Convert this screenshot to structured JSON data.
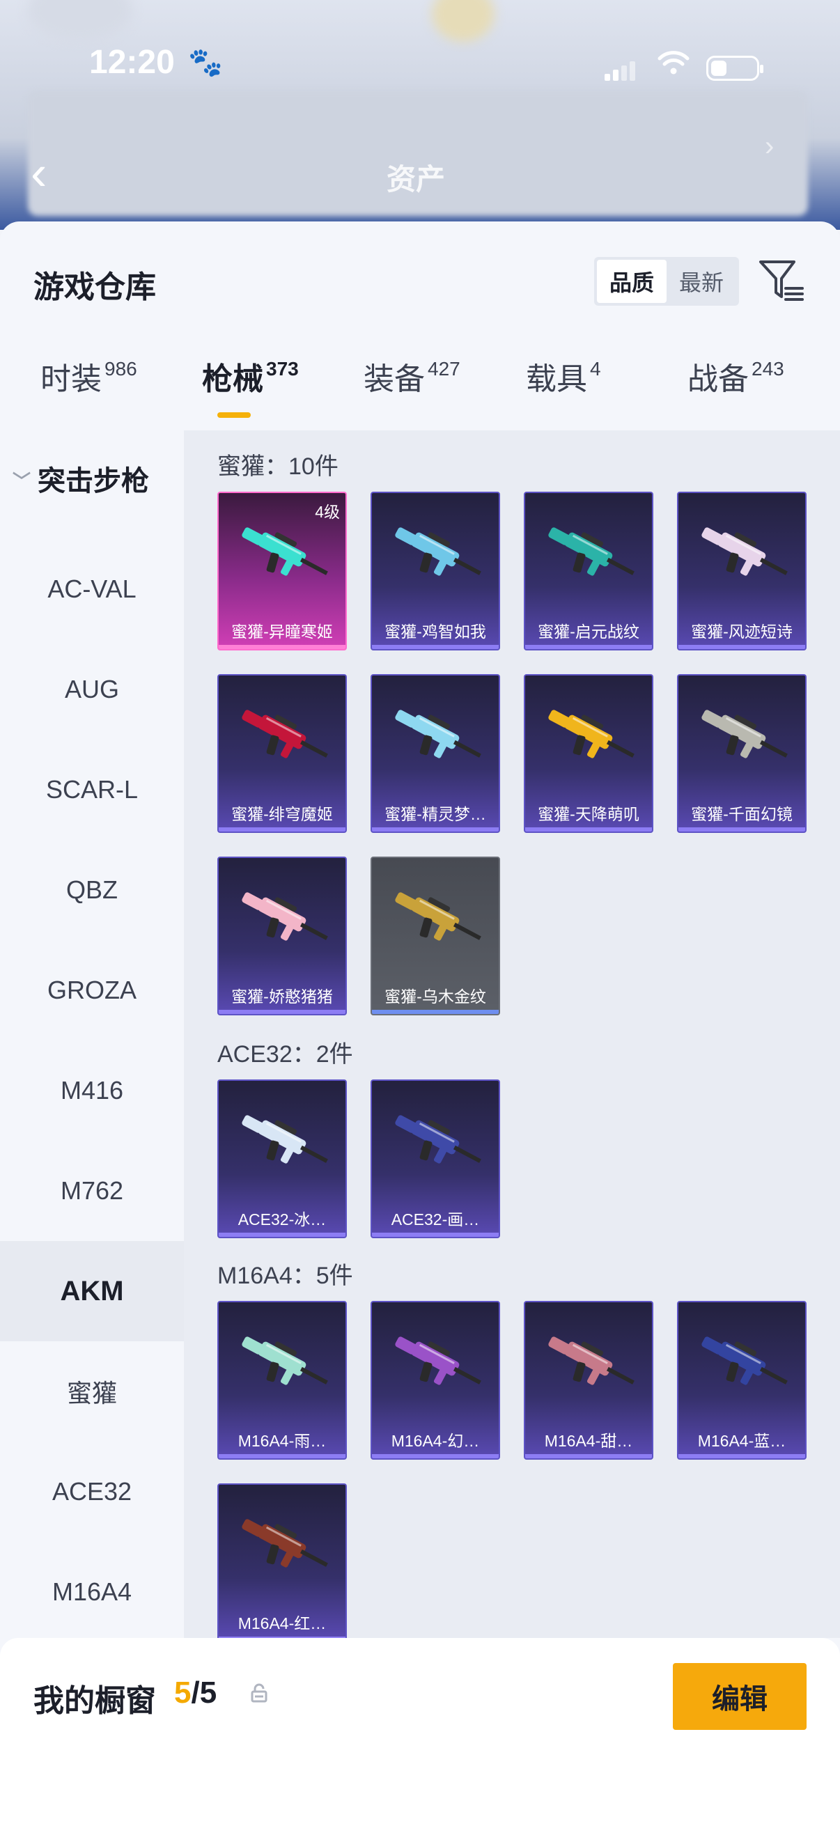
{
  "status_bar": {
    "time": "12:20",
    "paw_glyph": "🐾"
  },
  "header": {
    "title": "资产",
    "back_glyph": "‹",
    "next_glyph": "›"
  },
  "warehouse": {
    "title": "游戏仓库",
    "sort_options": [
      {
        "label": "品质",
        "active": true
      },
      {
        "label": "最新",
        "active": false
      }
    ]
  },
  "tabs": [
    {
      "label": "时装",
      "count": "986",
      "active": false
    },
    {
      "label": "枪械",
      "count": "373",
      "active": true
    },
    {
      "label": "装备",
      "count": "427",
      "active": false
    },
    {
      "label": "载具",
      "count": "4",
      "active": false
    },
    {
      "label": "战备",
      "count": "243",
      "active": false
    }
  ],
  "sidebar": {
    "group": "突击步枪",
    "items": [
      "AC-VAL",
      "AUG",
      "SCAR-L",
      "QBZ",
      "GROZA",
      "M416",
      "M762",
      "AKM",
      "蜜獾",
      "ACE32",
      "M16A4"
    ],
    "active_item": "AKM"
  },
  "groups": [
    {
      "header": "蜜獾：10件",
      "items": [
        {
          "name": "蜜獾-异瞳寒姬",
          "level": "4级",
          "rarity": "pink",
          "color": "#3be0d0"
        },
        {
          "name": "蜜獾-鸡智如我",
          "rarity": "purple",
          "color": "#6fc7e8"
        },
        {
          "name": "蜜獾-启元战纹",
          "rarity": "purple",
          "color": "#2bb3a8"
        },
        {
          "name": "蜜獾-风迹短诗",
          "rarity": "purple",
          "color": "#e7d4ea"
        },
        {
          "name": "蜜獾-绯穹魔姬",
          "rarity": "purple",
          "color": "#c4163a"
        },
        {
          "name": "蜜獾-精灵梦…",
          "rarity": "purple",
          "color": "#8ed8f0"
        },
        {
          "name": "蜜獾-天降萌叽",
          "rarity": "purple",
          "color": "#f0b51c"
        },
        {
          "name": "蜜獾-千面幻镜",
          "rarity": "purple",
          "color": "#b9b9b0"
        },
        {
          "name": "蜜獾-娇憨猪猪",
          "rarity": "purple",
          "color": "#f3b5c8"
        },
        {
          "name": "蜜獾-乌木金纹",
          "rarity": "gray",
          "color": "#c9a23a"
        }
      ]
    },
    {
      "header": "ACE32：2件",
      "items": [
        {
          "name": "ACE32-冰…",
          "rarity": "purple",
          "color": "#d8e6f5"
        },
        {
          "name": "ACE32-画…",
          "rarity": "purple",
          "color": "#3f4aa8"
        }
      ]
    },
    {
      "header": "M16A4：5件",
      "items": [
        {
          "name": "M16A4-雨…",
          "rarity": "purple",
          "color": "#9fe0d0"
        },
        {
          "name": "M16A4-幻…",
          "rarity": "purple",
          "color": "#9a52c8"
        },
        {
          "name": "M16A4-甜…",
          "rarity": "purple",
          "color": "#c77a8a"
        },
        {
          "name": "M16A4-蓝…",
          "rarity": "purple",
          "color": "#3344a0"
        },
        {
          "name": "M16A4-红…",
          "rarity": "purple",
          "color": "#8a3a2a"
        }
      ]
    }
  ],
  "showcase": {
    "label": "我的橱窗",
    "current": "5",
    "total": "/5",
    "edit_label": "编辑"
  },
  "colors": {
    "accent": "#f6a90c",
    "pink_rarity": "#d23fb6",
    "purple_rarity": "#5a4ab4",
    "gray_rarity": "#5c6068"
  }
}
